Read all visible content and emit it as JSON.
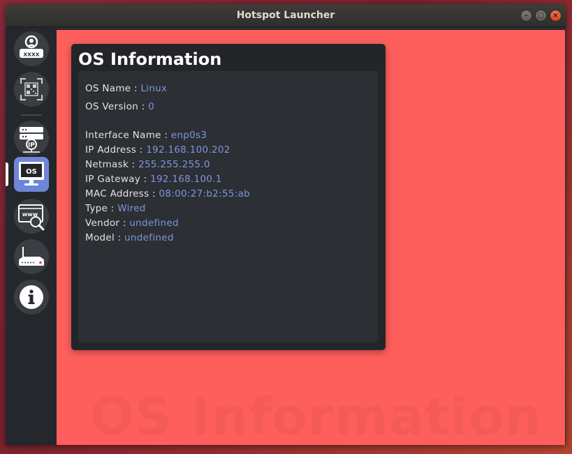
{
  "window": {
    "title": "Hotspot Launcher",
    "minimize_glyph": "–",
    "maximize_glyph": "□",
    "close_glyph": "×"
  },
  "sidebar": {
    "items": [
      {
        "icon": "user-password-icon",
        "label": "xxxx"
      },
      {
        "icon": "qr-code-icon"
      },
      {
        "icon": "ip-server-icon",
        "label": "IP"
      },
      {
        "icon": "os-monitor-icon",
        "label": "OS",
        "active": true
      },
      {
        "icon": "www-search-icon",
        "label": "www"
      },
      {
        "icon": "router-icon"
      },
      {
        "icon": "info-icon"
      }
    ]
  },
  "main": {
    "background_color": "#fe5f5c",
    "watermark": "OS Information",
    "card": {
      "title": "OS Information",
      "rows": [
        {
          "label": "OS Name : ",
          "value": "Linux"
        },
        {
          "label": "OS Version : ",
          "value": "0"
        },
        {
          "label": "Interface Name : ",
          "value": "enp0s3"
        },
        {
          "label": "IP Address : ",
          "value": "192.168.100.202"
        },
        {
          "label": "Netmask : ",
          "value": "255.255.255.0"
        },
        {
          "label": "IP Gateway : ",
          "value": "192.168.100.1"
        },
        {
          "label": "MAC Address : ",
          "value": "08:00:27:b2:55:ab"
        },
        {
          "label": "Type : ",
          "value": "Wired"
        },
        {
          "label": "Vendor : ",
          "value": "undefined"
        },
        {
          "label": "Model : ",
          "value": "undefined"
        }
      ]
    }
  },
  "colors": {
    "accent": "#6e86d8",
    "value_text": "#7f95e0",
    "sidebar_bg": "#24272b",
    "card_bg": "#232529"
  }
}
